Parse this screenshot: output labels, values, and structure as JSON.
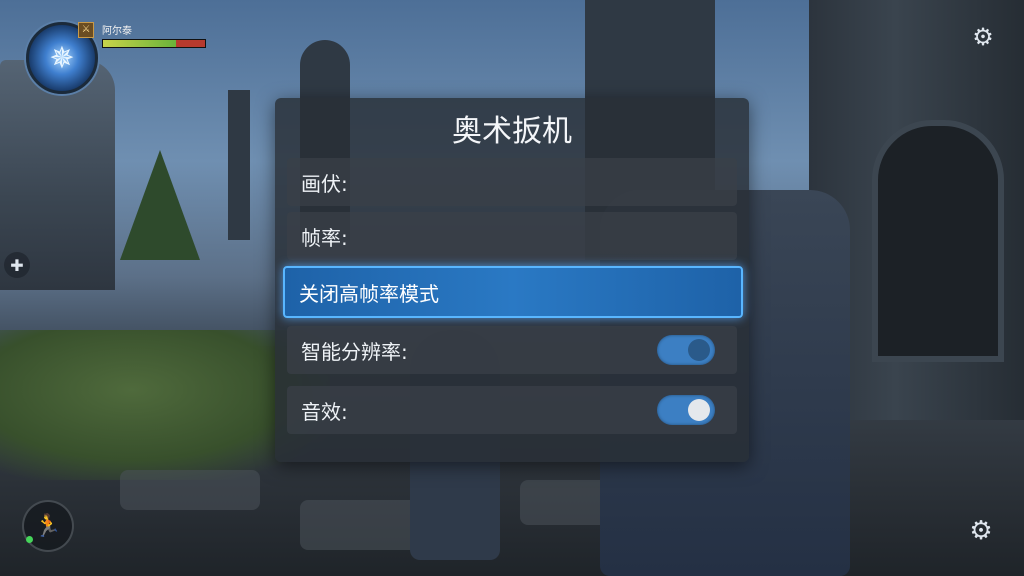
{
  "hud": {
    "player_name": "阿尔泰",
    "health_fraction": 0.72,
    "level_badge": "⚔"
  },
  "panel": {
    "title": "奥术扳机",
    "rows": [
      {
        "label": "画伏:"
      },
      {
        "label": "帧率:"
      },
      {
        "label": "关闭高帧率模式",
        "selected": true
      },
      {
        "label": "智能分辨率:",
        "toggle": true,
        "on": true
      },
      {
        "label": "音效:",
        "toggle": true,
        "on": true
      }
    ]
  },
  "icons": {
    "settings": "gear-icon",
    "side_button": "plus-icon",
    "skill": "runner-icon",
    "portrait": "star-emblem-icon"
  },
  "colors": {
    "highlight": "#2a79c4",
    "toggle_on": "#3c7fc3",
    "knob_dark": "#2a5a8a",
    "knob_light": "#e4e8ec"
  }
}
